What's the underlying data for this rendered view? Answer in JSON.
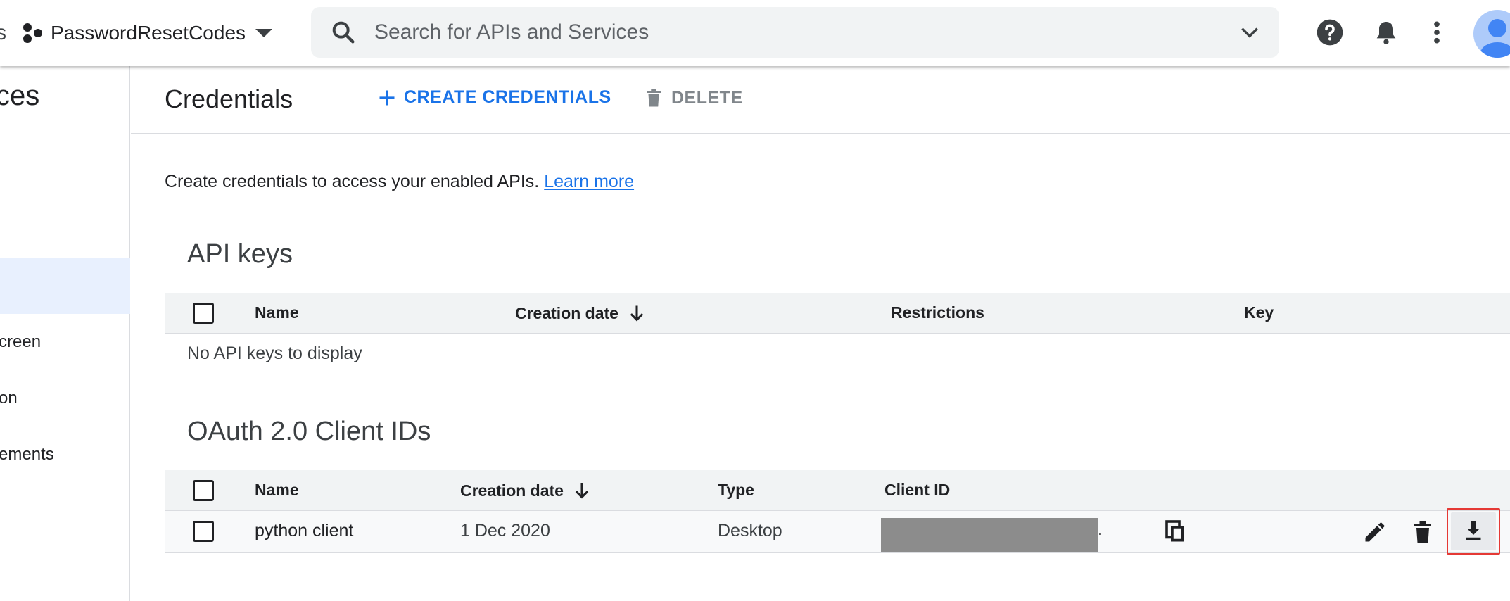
{
  "topbar": {
    "project_name": "PasswordResetCodes",
    "search_placeholder": "Search for APIs and Services"
  },
  "nav": {
    "title": "ces",
    "items": [
      {
        "label": "creen"
      },
      {
        "label": "on"
      },
      {
        "label": "ements"
      }
    ]
  },
  "header": {
    "title": "Credentials",
    "create_label": "CREATE CREDENTIALS",
    "delete_label": "DELETE"
  },
  "intro": {
    "text": "Create credentials to access your enabled APIs.",
    "link": "Learn more"
  },
  "api_keys": {
    "title": "API keys",
    "columns": [
      "Name",
      "Creation date",
      "Restrictions",
      "Key"
    ],
    "empty_text": "No API keys to display"
  },
  "oauth": {
    "title": "OAuth 2.0 Client IDs",
    "columns": [
      "Name",
      "Creation date",
      "Type",
      "Client ID"
    ],
    "rows": [
      {
        "name": "python client",
        "creation_date": "1 Dec 2020",
        "type": "Desktop",
        "client_id_suffix": "."
      }
    ]
  },
  "colors": {
    "accent": "#1a73e8",
    "highlight_border": "#e53935",
    "redaction": "#8c8c8c"
  },
  "icons": [
    "project-icon",
    "caret-down-icon",
    "search-icon",
    "chevron-down-icon",
    "help-icon",
    "bell-icon",
    "more-vert-icon",
    "avatar",
    "plus-icon",
    "trash-icon",
    "arrow-down-icon",
    "copy-icon",
    "edit-icon",
    "download-icon"
  ]
}
